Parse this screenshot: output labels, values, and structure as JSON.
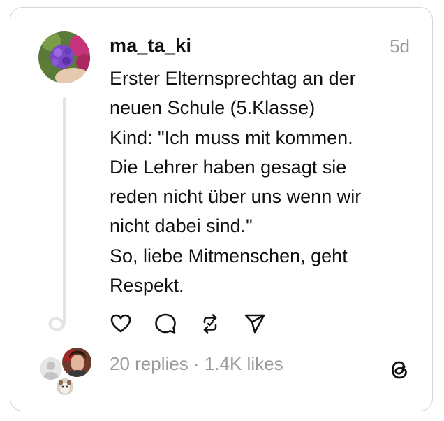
{
  "post": {
    "username": "ma_ta_ki",
    "timestamp": "5d",
    "text_lines": [
      "Erster Elternsprechtag an der",
      "neuen Schule (5.Klasse)",
      "Kind: \"Ich muss mit kommen.",
      "Die Lehrer haben gesagt sie",
      "reden nicht über uns wenn wir",
      "nicht dabei sind.\"",
      "So, liebe Mitmenschen, geht",
      "Respekt."
    ]
  },
  "actions": {
    "icons": [
      "heart-icon",
      "comment-icon",
      "repost-icon",
      "share-icon"
    ]
  },
  "stats": {
    "replies": "20 replies",
    "separator": " · ",
    "likes": "1.4K likes"
  },
  "colors": {
    "text": "#111111",
    "muted": "#9a9a9a",
    "border": "#d6d6d6",
    "thread_line": "#e4e4e4"
  }
}
